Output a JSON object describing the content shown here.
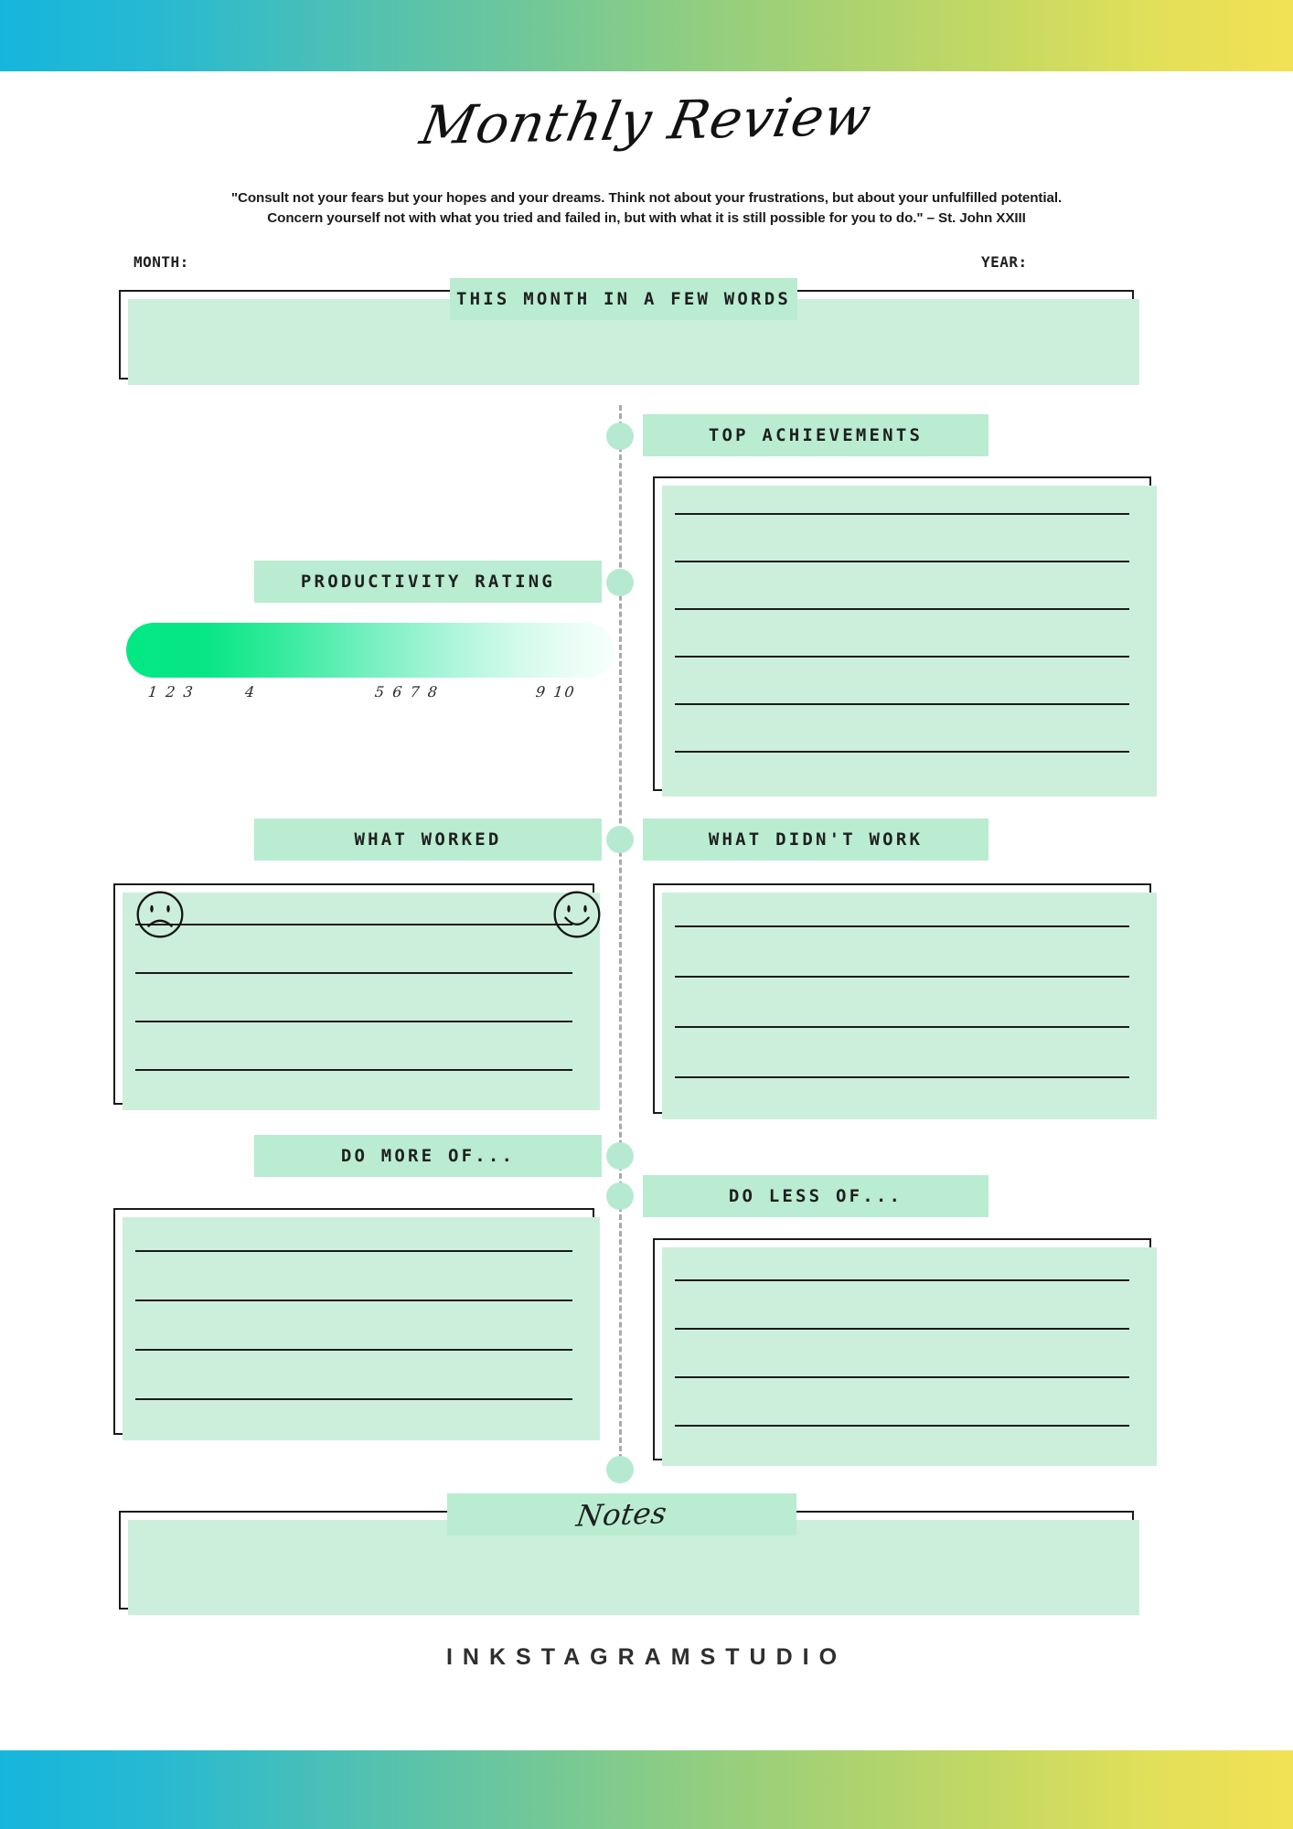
{
  "document": {
    "title": "Monthly Review",
    "brand": "INKSTAGRAMSTUDIO",
    "quote_line1": "\"Consult not your fears but your hopes and your dreams. Think not about your frustrations, but about your unfulfilled potential.",
    "quote_line2": "Concern yourself not with what you tried and failed in, but with what it is still possible for you to do.\" – St. John XXIII"
  },
  "colors": {
    "band_start": "#16b6dc",
    "band_end": "#f2e155",
    "banner_mint": "#b9ecd1",
    "node_mint": "#b6ead0",
    "box_shadow_mint": "#ccefdb",
    "rating_high": "#04e884",
    "rating_low": "#f7fffc",
    "ink": "#1a1a1a"
  },
  "fields": {
    "month_label": "MONTH:",
    "month_value": "",
    "year_label": "YEAR:",
    "year_value": ""
  },
  "sections": {
    "few_words": {
      "header": "THIS MONTH IN A FEW WORDS",
      "lines": 0
    },
    "top_achievements": {
      "header": "TOP ACHIEVEMENTS",
      "lines": 6
    },
    "productivity": {
      "header": "PRODUCTIVITY RATING",
      "icon_low": "frowning-face-icon",
      "icon_high": "smiling-face-icon",
      "scale_marks": [
        "1 2 3",
        "4",
        "5 6 7 8",
        "9 10"
      ]
    },
    "what_worked": {
      "header": "WHAT WORKED",
      "lines": 4
    },
    "what_didnt_work": {
      "header": "WHAT DIDN'T WORK",
      "lines": 4
    },
    "do_more_of": {
      "header": "DO MORE OF...",
      "lines": 4
    },
    "do_less_of": {
      "header": "DO LESS OF...",
      "lines": 4
    },
    "notes": {
      "header": "Notes",
      "lines": 0
    }
  }
}
